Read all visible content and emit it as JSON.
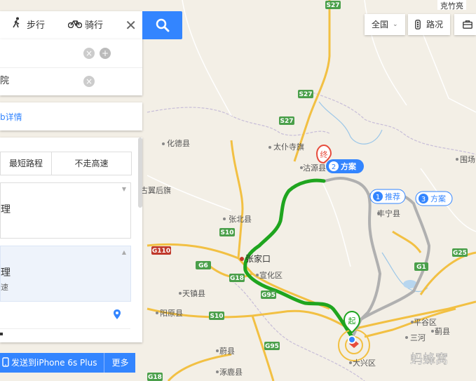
{
  "route_panel": {
    "modes": [
      {
        "label": "步行",
        "icon": "walk-icon"
      },
      {
        "label": "骑行",
        "icon": "bike-icon"
      }
    ],
    "close_icon": "close-icon",
    "search_icon": "search-icon",
    "start_text": "",
    "end_text": "院",
    "detail_link": "b详情",
    "tabs": [
      "最短路程",
      "不走高速"
    ],
    "routes": [
      {
        "title": "理",
        "sub": ""
      },
      {
        "title": "理",
        "sub": "速"
      }
    ],
    "send_label": "发送到iPhone 6s Plus",
    "more_label": "更多"
  },
  "controls": {
    "region": "全国",
    "traffic": "路况",
    "partial": "克竹亮"
  },
  "map": {
    "cities": [
      {
        "name": "化德县"
      },
      {
        "name": "太仆寺旗"
      },
      {
        "name": "沽源县"
      },
      {
        "name": "围场"
      },
      {
        "name": "丰宁县"
      },
      {
        "name": "张北县"
      },
      {
        "name": "古翼后旗"
      },
      {
        "name": "张家口"
      },
      {
        "name": "宣化区"
      },
      {
        "name": "天镇县"
      },
      {
        "name": "阳原县"
      },
      {
        "name": "蔚县"
      },
      {
        "name": "涿鹿县"
      },
      {
        "name": "平谷区"
      },
      {
        "name": "蓟县"
      },
      {
        "name": "三河"
      },
      {
        "name": "大兴区"
      }
    ],
    "highways": [
      "S27",
      "S27",
      "S27",
      "S10",
      "G110",
      "G6",
      "G18",
      "G95",
      "G95",
      "S10",
      "G18",
      "G25",
      "G1"
    ],
    "route_labels": [
      {
        "num": "1",
        "label": "推荐"
      },
      {
        "num": "2",
        "label": "方案"
      },
      {
        "num": "3",
        "label": "方案"
      }
    ],
    "end_marker": "终",
    "start_marker": "起",
    "watermark": "蚂蜂窝"
  }
}
